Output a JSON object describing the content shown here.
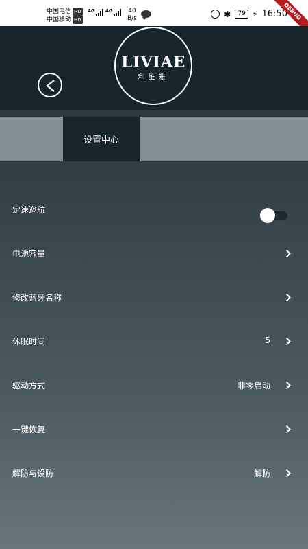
{
  "status_bar": {
    "carrier1": "中国电信",
    "carrier2": "中国移动",
    "hd": "HD",
    "network": "4G",
    "speed_value": "40",
    "speed_unit": "B/s",
    "battery": "79",
    "time": "16:50",
    "debug_label": "DEBUG"
  },
  "header": {
    "logo_text": "LIVIAE",
    "logo_subtext": "利维雅",
    "back_icon": "chevron-left-circle-icon"
  },
  "tabs": [
    {
      "label": "设置中心",
      "active": true
    }
  ],
  "settings": {
    "items": [
      {
        "label": "定速巡航",
        "type": "toggle",
        "enabled": false
      },
      {
        "label": "电池容量",
        "type": "nav",
        "value": ""
      },
      {
        "label": "修改蓝牙名称",
        "type": "nav",
        "value": ""
      },
      {
        "label": "休眠时间",
        "type": "nav",
        "value": "5"
      },
      {
        "label": "驱动方式",
        "type": "nav",
        "value": "非零启动"
      },
      {
        "label": "一键恢复",
        "type": "nav",
        "value": ""
      },
      {
        "label": "解防与设防",
        "type": "nav",
        "value": "解防"
      }
    ]
  },
  "colors": {
    "header_bg": "#17262c",
    "tab_bar_bg": "#7f8f95",
    "content_top": "#2f3d44",
    "content_bottom": "#67767c",
    "debug_ribbon": "#b71c1c"
  }
}
